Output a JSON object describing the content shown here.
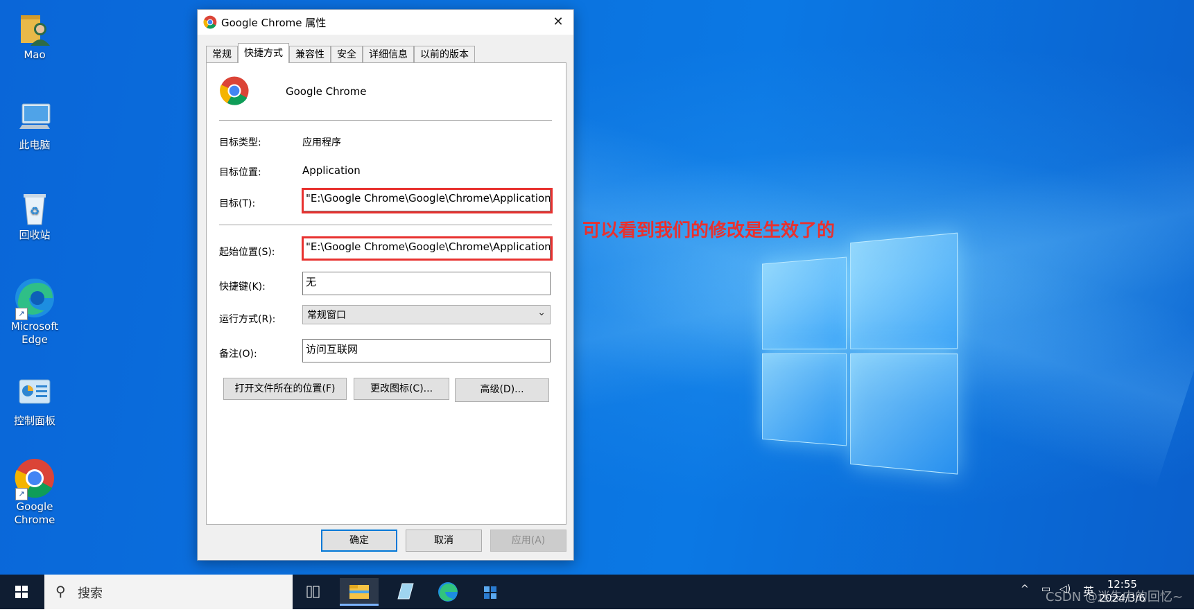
{
  "desktop": {
    "icons": [
      {
        "label": "Mao"
      },
      {
        "label": "此电脑"
      },
      {
        "label": "回收站"
      },
      {
        "label": "Microsoft Edge"
      },
      {
        "label": "控制面板"
      },
      {
        "label": "Google Chrome"
      }
    ],
    "annotation": "可以看到我们的修改是生效了的"
  },
  "dialog": {
    "title": "Google Chrome 属性",
    "tabs": [
      "常规",
      "快捷方式",
      "兼容性",
      "安全",
      "详细信息",
      "以前的版本"
    ],
    "active_tab": "快捷方式",
    "app_name": "Google Chrome",
    "target_type_label": "目标类型:",
    "target_type_value": "应用程序",
    "target_location_label": "目标位置:",
    "target_location_value": "Application",
    "target_label": "目标(T):",
    "target_value": "\"E:\\Google Chrome\\Google\\Chrome\\Application",
    "start_in_label": "起始位置(S):",
    "start_in_value": "\"E:\\Google Chrome\\Google\\Chrome\\Application",
    "shortcut_key_label": "快捷键(K):",
    "shortcut_key_value": "无",
    "run_label": "运行方式(R):",
    "run_value": "常规窗口",
    "comment_label": "备注(O):",
    "comment_value": "访问互联网",
    "open_location_btn": "打开文件所在的位置(F)",
    "change_icon_btn": "更改图标(C)...",
    "advanced_btn": "高级(D)...",
    "ok_btn": "确定",
    "cancel_btn": "取消",
    "apply_btn": "应用(A)"
  },
  "taskbar": {
    "search_placeholder": "搜索",
    "ime": "英",
    "time": "12:55",
    "date": "2024/3/6",
    "watermark": "CSDN @迷失中的回忆~"
  },
  "colors": {
    "annotation_red": "#e8312f",
    "desktop_blue": "#0b74e0",
    "taskbar": "#0f1d32"
  }
}
